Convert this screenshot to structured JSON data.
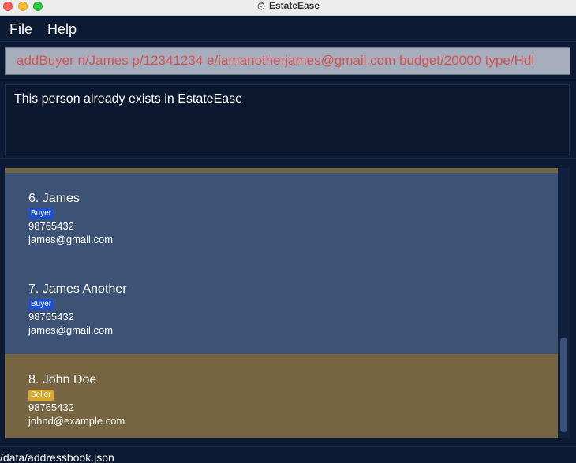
{
  "window": {
    "title": "EstateEase",
    "app_icon": "estateease-app-icon"
  },
  "menu": {
    "file": "File",
    "help": "Help"
  },
  "command": {
    "value": "addBuyer n/James p/12341234 e/iamanotherjames@gmail.com budget/20000 type/Hdl",
    "text_color": "#d9534f"
  },
  "result": {
    "message": "This person already exists in EstateEase"
  },
  "persons": [
    {
      "index": "6.",
      "name": "James",
      "tag": "Buyer",
      "phone": "98765432",
      "email": "james@gmail.com"
    },
    {
      "index": "7.",
      "name": "James Another",
      "tag": "Buyer",
      "phone": "98765432",
      "email": "james@gmail.com"
    },
    {
      "index": "8.",
      "name": "John Doe",
      "tag": "Seller",
      "phone": "98765432",
      "email": "johnd@example.com"
    }
  ],
  "colors": {
    "background": "#0d1a33",
    "buyer_card": "#3c5375",
    "seller_card": "#766540",
    "buyer_tag": "#1c4fd1",
    "seller_tag": "#d9a72a"
  },
  "status": {
    "path": "/data/addressbook.json"
  }
}
